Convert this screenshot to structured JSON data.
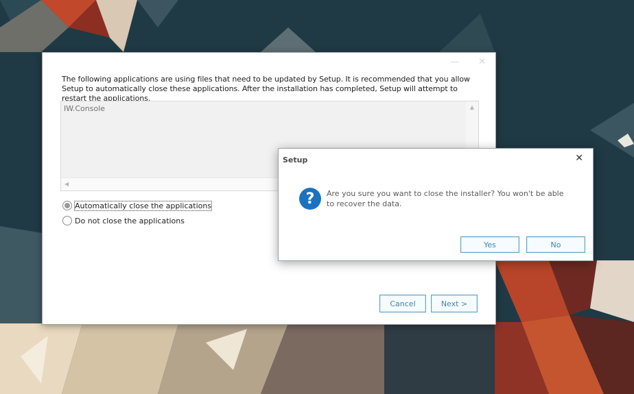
{
  "colors": {
    "accent": "#3b84b7",
    "question_icon": "#1a73c1",
    "desktop": "#1f3a45"
  },
  "main_window": {
    "controls": {
      "minimize": "—",
      "close": "✕"
    },
    "intro_text": "The following applications are using files that need to be updated by Setup. It is recommended that you allow Setup to automatically close these applications. After the installation has completed, Setup will attempt to restart the applications.",
    "app_list": {
      "items": [
        "IW.Console"
      ]
    },
    "options": {
      "auto_close": {
        "label": "Automatically close the applications",
        "checked": true
      },
      "do_not_close": {
        "label": "Do not close the applications",
        "checked": false
      }
    },
    "buttons": {
      "cancel": "Cancel",
      "next": "Next >"
    }
  },
  "dialog": {
    "title": "Setup",
    "close": "✕",
    "icon": "question-icon",
    "message": " Are you sure you want to close the installer? You won't be able to recover the data.",
    "buttons": {
      "yes": "Yes",
      "no": "No"
    }
  }
}
